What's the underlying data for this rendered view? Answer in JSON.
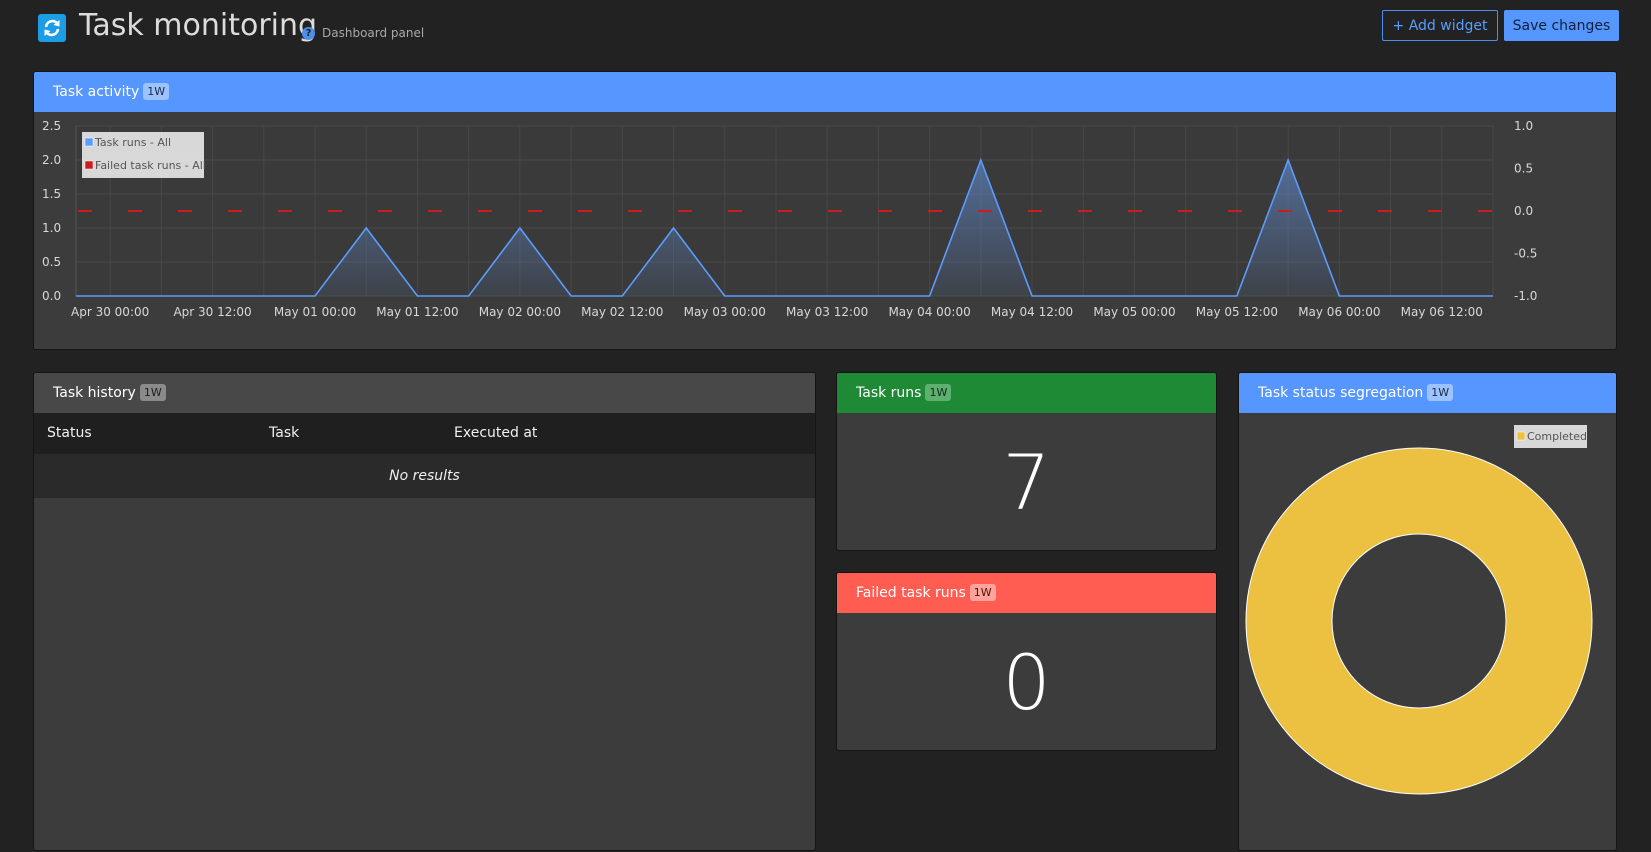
{
  "header": {
    "title": "Task monitoring",
    "subtitle": "Dashboard panel",
    "add_widget_label": "+ Add widget",
    "save_label": "Save changes",
    "icon": "refresh-icon",
    "help_glyph": "?"
  },
  "task_activity": {
    "title": "Task activity",
    "badge": "1W"
  },
  "task_history": {
    "title": "Task history",
    "badge": "1W",
    "columns": [
      "Status",
      "Task",
      "Executed at"
    ],
    "empty_text": "No results"
  },
  "task_runs": {
    "title": "Task runs",
    "badge": "1W",
    "value": "7"
  },
  "failed_task_runs": {
    "title": "Failed task runs",
    "badge": "1W",
    "value": "0"
  },
  "task_status_segregation": {
    "title": "Task status segregation",
    "badge": "1W"
  },
  "colors": {
    "accent_blue": "#5596ff",
    "success_green": "#1f8a35",
    "danger_red": "#ff5c52",
    "completed_yellow": "#ecc040",
    "failed_series_red": "#cc1c1c"
  },
  "chart_data": [
    {
      "type": "area",
      "x_tick_labels": [
        "Apr 30 00:00",
        "Apr 30 12:00",
        "May 01 00:00",
        "May 01 12:00",
        "May 02 00:00",
        "May 02 12:00",
        "May 03 00:00",
        "May 03 12:00",
        "May 04 00:00",
        "May 04 12:00",
        "May 05 00:00",
        "May 05 12:00",
        "May 06 00:00",
        "May 06 12:00"
      ],
      "y_left": {
        "ylim": [
          0,
          2.5
        ],
        "ticks": [
          "0.0",
          "0.5",
          "1.0",
          "1.5",
          "2.0",
          "2.5"
        ]
      },
      "y_right": {
        "ylim": [
          -1.0,
          1.0
        ],
        "ticks": [
          "-1.0",
          "-0.5",
          "0.0",
          "0.5",
          "1.0"
        ]
      },
      "grid": true,
      "legend_position": "top-left",
      "series": [
        {
          "name": "Task runs - All",
          "color": "#5b9cff",
          "axis": "left",
          "style": "area",
          "x": [
            "Apr 29 20:00",
            "May 01 00:00",
            "May 01 06:00",
            "May 01 12:00",
            "May 01 18:00",
            "May 02 00:00",
            "May 02 06:00",
            "May 02 12:00",
            "May 02 18:00",
            "May 03 00:00",
            "May 03 06:00",
            "May 04 00:00",
            "May 04 06:00",
            "May 04 12:00",
            "May 04 18:00",
            "May 05 12:00",
            "May 05 18:00",
            "May 06 00:00",
            "May 06 18:00"
          ],
          "y": [
            0,
            0,
            1,
            0,
            0,
            1,
            0,
            0,
            1,
            0,
            0,
            0,
            2,
            0,
            0,
            0,
            2,
            0,
            0
          ]
        },
        {
          "name": "Failed task runs - All",
          "color": "#cc1c1c",
          "axis": "right",
          "style": "dashed",
          "x": [
            "Apr 29 20:00",
            "May 06 18:00"
          ],
          "y": [
            0,
            0
          ]
        }
      ]
    },
    {
      "type": "pie",
      "variant": "donut",
      "legend_position": "top-right",
      "slices": [
        {
          "label": "Completed",
          "value": 7,
          "color": "#ecc040"
        }
      ]
    }
  ]
}
